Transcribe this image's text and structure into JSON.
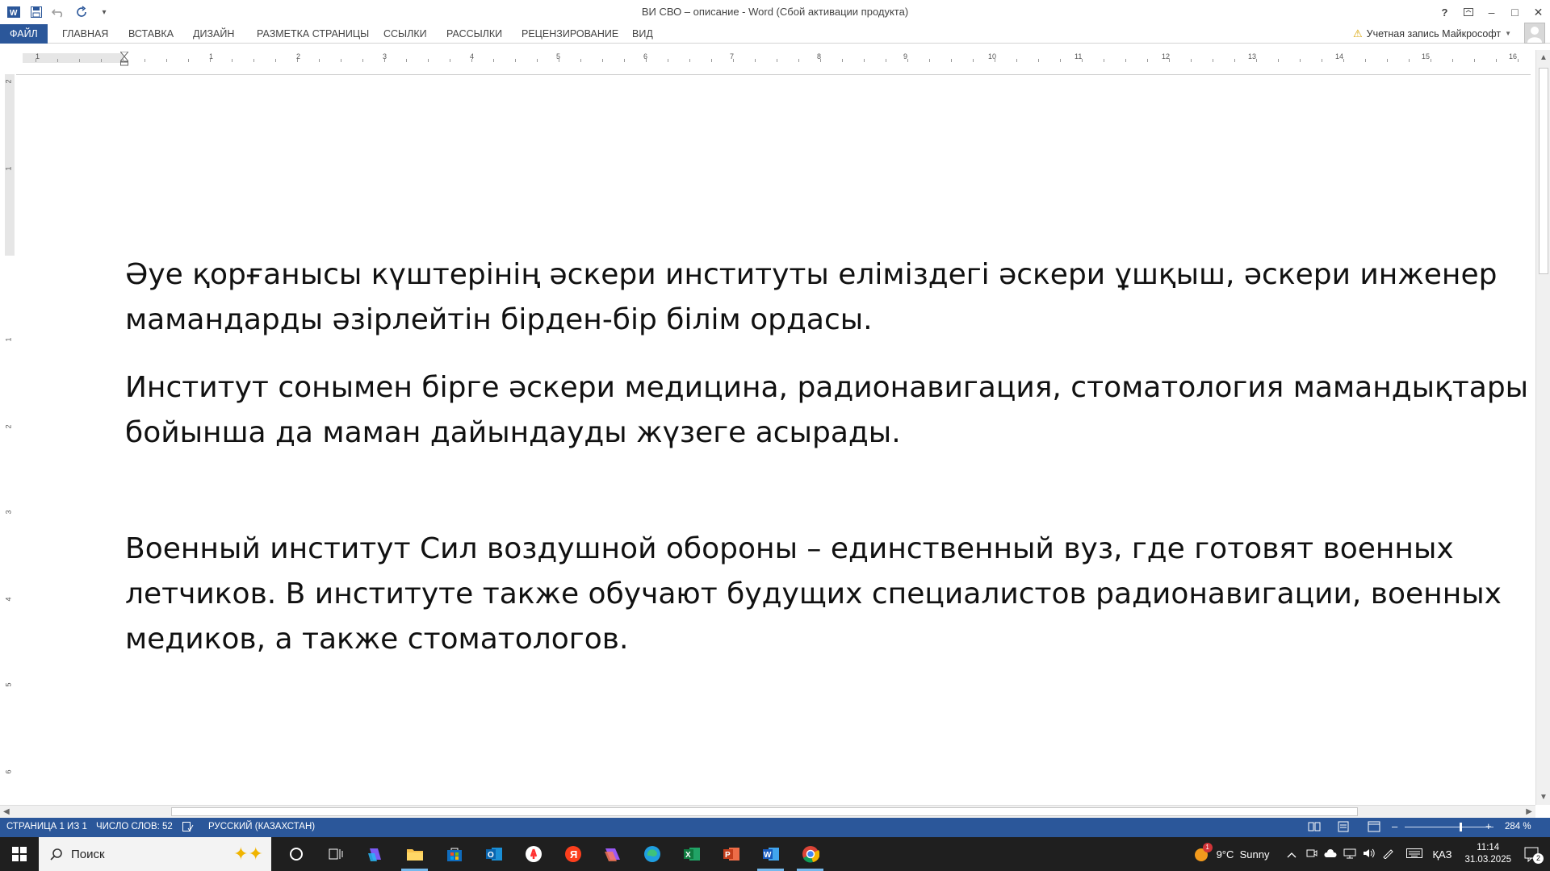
{
  "window": {
    "title": "ВИ СВО – описание - Word (Сбой активации продукта)",
    "controls": {
      "help": "?",
      "minimize": "–",
      "maximize": "□",
      "close": "✕"
    }
  },
  "qat": {
    "app_icon": "word-icon",
    "save": "save-icon",
    "undo": "undo-icon",
    "redo": "redo-icon",
    "customize": "▾"
  },
  "ribbon": {
    "tabs": [
      "ФАЙЛ",
      "ГЛАВНАЯ",
      "ВСТАВКА",
      "ДИЗАЙН",
      "РАЗМЕТКА СТРАНИЦЫ",
      "ССЫЛКИ",
      "РАССЫЛКИ",
      "РЕЦЕНЗИРОВАНИЕ",
      "ВИД"
    ],
    "account": "Учетная запись Майкрософт"
  },
  "ruler": {
    "h_numbers": [
      "1",
      "1",
      "2",
      "3",
      "4",
      "5",
      "6",
      "7",
      "8",
      "9",
      "10",
      "11",
      "12",
      "13",
      "14",
      "15",
      "16"
    ],
    "v_numbers": [
      "2",
      "1",
      "1",
      "2",
      "3",
      "4",
      "5",
      "6"
    ],
    "corner": "L"
  },
  "document": {
    "paragraphs": [
      "Әуе қорғанысы күштерінің әскери институты еліміздегі әскери ұшқыш, әскери инженер мамандарды әзірлейтін бірден-бір білім ордасы.",
      "Институт сонымен бірге әскери медицина, радионавигация, стоматология мамандықтары бойынша да маман дайындауды жүзеге асырады.",
      "Военный институт Сил воздушной обороны – единственный вуз, где готовят военных летчиков. В институте также обучают будущих специалистов радионавигации, военных медиков, а также стоматологов."
    ]
  },
  "status": {
    "page": "СТРАНИЦА 1 ИЗ 1",
    "words": "ЧИСЛО СЛОВ: 52",
    "language": "РУССКИЙ (КАЗАХСТАН)",
    "zoom": "284 %",
    "zoom_minus": "–",
    "zoom_plus": "+"
  },
  "taskbar": {
    "search_placeholder": "Поиск",
    "weather": "9°C  Sunny",
    "language": "ҚАЗ",
    "time": "11:14",
    "date": "31.03.2025",
    "notifications": "2",
    "weather_badge": "1"
  }
}
